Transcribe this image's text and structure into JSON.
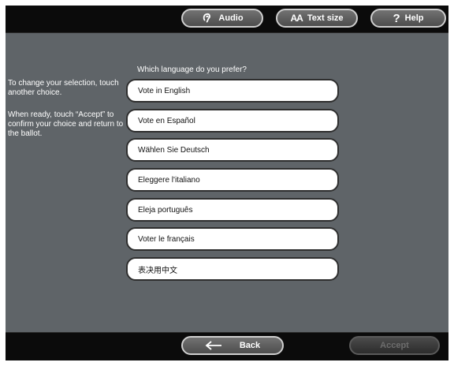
{
  "header": {
    "audio_label": "Audio",
    "text_size_glyph": "AA",
    "text_size_label": "Text size",
    "help_glyph": "?",
    "help_label": "Help"
  },
  "instructions": {
    "line1": "To change your selection, touch another choice.",
    "line2": "When ready, touch “Accept” to confirm your choice and return to the ballot."
  },
  "prompt": "Which language do you prefer?",
  "choices": [
    "Vote in English",
    "Vote en Español",
    "Wählen Sie Deutsch",
    "Eleggere l'italiano",
    "Eleja português",
    "Voter le français",
    "表决用中文"
  ],
  "footer": {
    "back_label": "Back",
    "accept_label": "Accept"
  }
}
